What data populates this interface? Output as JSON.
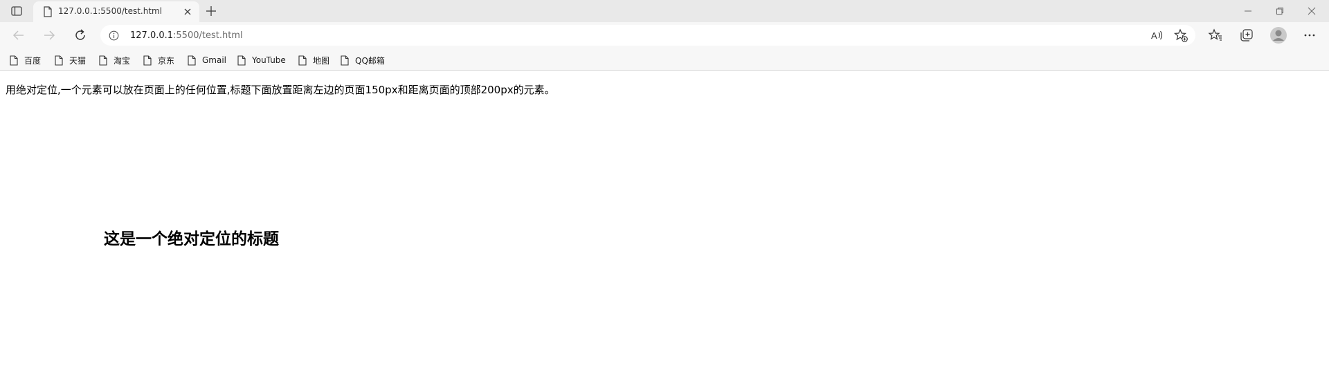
{
  "browser": {
    "tab": {
      "title": "127.0.0.1:5500/test.html"
    },
    "address": {
      "host": "127.0.0.1",
      "path": ":5500/test.html"
    },
    "bookmarks": [
      "百度",
      "天猫",
      "淘宝",
      "京东",
      "Gmail",
      "YouTube",
      "地图",
      "QQ邮箱"
    ],
    "icons": {
      "tab_actions": "tab-actions-icon",
      "favicon": "page-icon",
      "close": "close-icon",
      "new_tab": "plus-icon",
      "back": "back-arrow-icon",
      "forward": "forward-arrow-icon",
      "refresh": "refresh-icon",
      "info": "info-icon",
      "read_aloud": "read-aloud-icon",
      "add_favorite": "star-add-icon",
      "favorites": "favorites-icon",
      "collections": "collections-icon",
      "profile": "profile-icon",
      "menu": "more-icon"
    }
  },
  "page": {
    "paragraph": "用绝对定位,一个元素可以放在页面上的任何位置,标题下面放置距离左边的页面150px和距离页面的顶部200px的元素。",
    "heading": "这是一个绝对定位的标题"
  },
  "colors": {
    "tabstrip": "#e9e9e9",
    "toolbar": "#f7f7f7",
    "addressbar": "#ffffff",
    "path_text": "#6b6b6b"
  }
}
